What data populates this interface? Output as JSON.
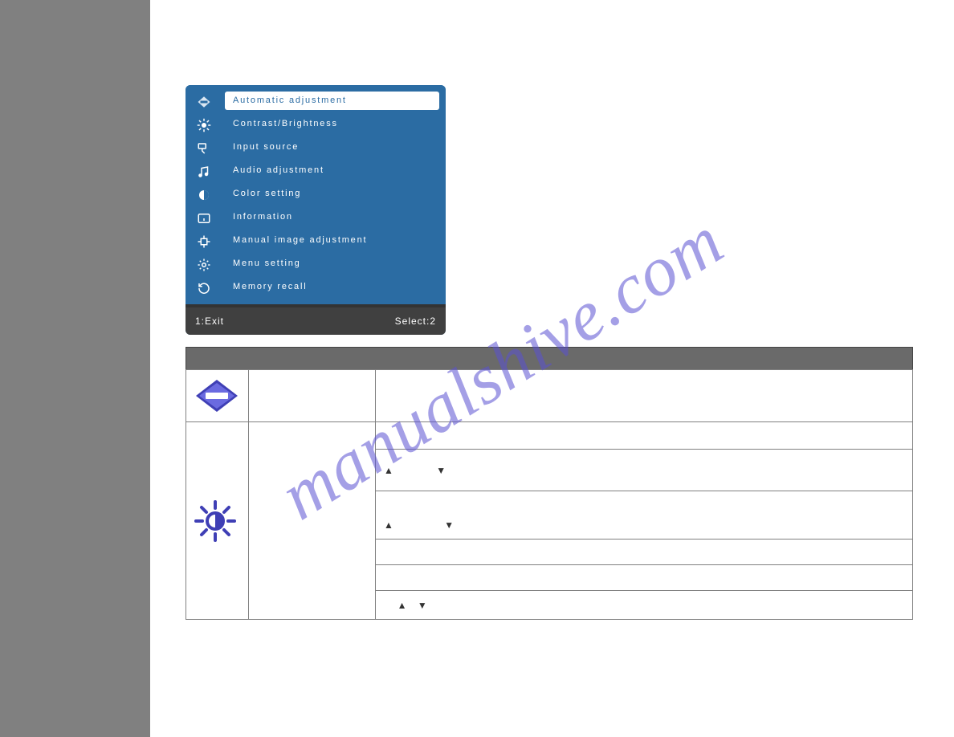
{
  "osd": {
    "items": [
      {
        "label": "Automatic adjustment"
      },
      {
        "label": "Contrast/Brightness"
      },
      {
        "label": "Input source"
      },
      {
        "label": "Audio adjustment"
      },
      {
        "label": "Color setting"
      },
      {
        "label": "Information"
      },
      {
        "label": "Manual image adjustment"
      },
      {
        "label": "Menu setting"
      },
      {
        "label": "Memory recall"
      }
    ],
    "footer_left": "1:Exit",
    "footer_right": "Select:2"
  },
  "icons": {
    "auto": "auto-icon",
    "brightness": "brightness-icon",
    "input": "input-icon",
    "audio": "audio-icon",
    "color": "color-icon",
    "info": "info-icon",
    "manual": "manual-icon",
    "menu": "menu-gear-icon",
    "recall": "recall-icon"
  },
  "glyphs": {
    "up": "▲",
    "down": "▼"
  },
  "watermark": "manualshive.com",
  "table": {
    "rows": [
      {
        "up1": "▲",
        "down1": "▼"
      },
      {
        "up1": "▲",
        "down1": "▼"
      },
      {
        "up1": "▲",
        "down1": "▼"
      }
    ]
  }
}
